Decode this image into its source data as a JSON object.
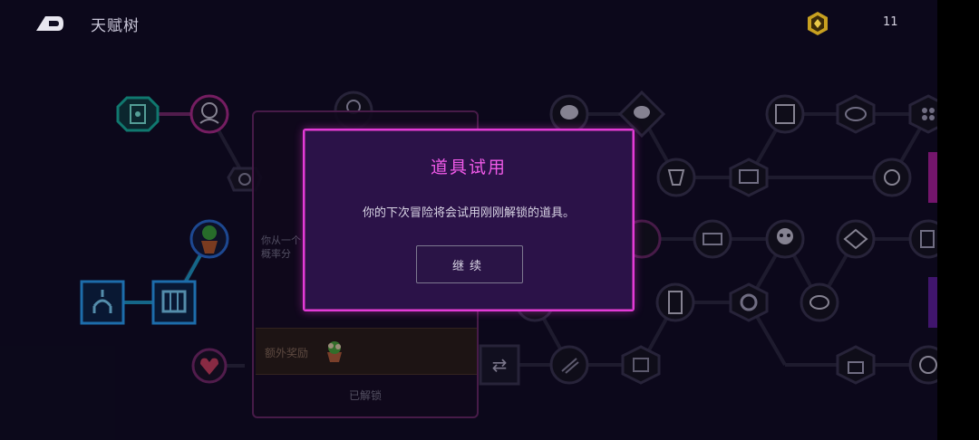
{
  "header": {
    "title": "天赋树",
    "currency_count": "11",
    "back_icon": "back-arrow-icon",
    "currency_icon": "gem-coin-icon"
  },
  "colors": {
    "accent": "#e43ad8",
    "dialog_bg": "#2b1248",
    "unlocked_teal": "#16b7a4",
    "unlocked_blue": "#2aa6ff",
    "node_ring": "#3a3550",
    "background": "#100c22"
  },
  "detail_panel": {
    "description": "你从一个\n概率分",
    "bonus_label": "额外奖励",
    "bonus_icon": "potted-plant-icon",
    "status": "已解锁"
  },
  "dialog": {
    "title": "道具试用",
    "message": "你的下次冒险将会试用刚刚解锁的道具。",
    "button_label": "继续"
  }
}
